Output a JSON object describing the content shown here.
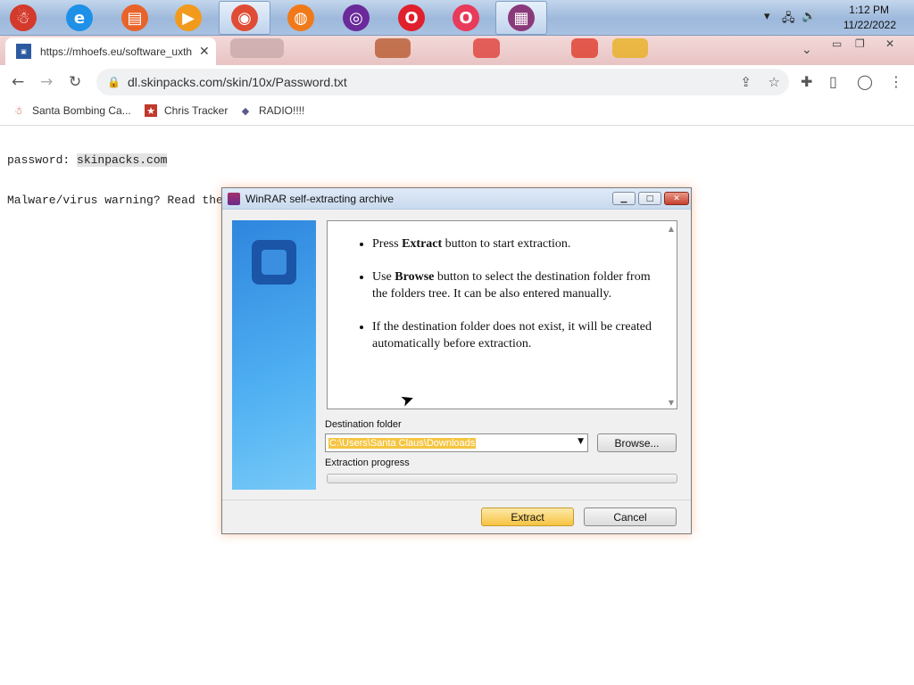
{
  "taskbar": {
    "apps": [
      {
        "name": "santa-icon",
        "color": "#d33a2c",
        "glyph": "☃"
      },
      {
        "name": "internet-explorer-icon",
        "color": "#1e90e8",
        "glyph": "e"
      },
      {
        "name": "file-explorer-icon",
        "color": "#e8632a",
        "glyph": "▤"
      },
      {
        "name": "media-player-icon",
        "color": "#f29a1d",
        "glyph": "▶"
      },
      {
        "name": "chrome-icon",
        "color": "#e04b35",
        "glyph": "◉"
      },
      {
        "name": "firefox-icon",
        "color": "#f07a1a",
        "glyph": "◍"
      },
      {
        "name": "tor-browser-icon",
        "color": "#6a2a9a",
        "glyph": "◎"
      },
      {
        "name": "opera-icon",
        "color": "#e0202c",
        "glyph": "O"
      },
      {
        "name": "opera-gx-icon",
        "color": "#e83a5a",
        "glyph": "O"
      },
      {
        "name": "winrar-icon",
        "color": "#8a3a7a",
        "glyph": "▦"
      }
    ],
    "time": "1:12 PM",
    "date": "11/22/2022"
  },
  "browser": {
    "tab_title": "https://mhoefs.eu/software_uxth",
    "url": "dl.skinpacks.com/skin/10x/Password.txt",
    "bookmarks": [
      "Santa Bombing Ca...",
      "Chris Tracker",
      "RADIO!!!!"
    ]
  },
  "page": {
    "password_label": "password:",
    "password_value": "skinpacks.com",
    "warning_text": "Malware/virus warning? Read the FA"
  },
  "dialog": {
    "title": "WinRAR self-extracting archive",
    "bullets": [
      {
        "pre": "Press ",
        "bold": "Extract",
        "post": " button to start extraction."
      },
      {
        "pre": "Use ",
        "bold": "Browse",
        "post": " button to select the destination folder from the folders tree. It can be also entered manually."
      },
      {
        "pre": "",
        "bold": "",
        "post": "If the destination folder does not exist, it will be created automatically before extraction."
      }
    ],
    "destination_label": "Destination folder",
    "destination_value": "C:\\Users\\Santa Claus\\Downloads",
    "browse_label": "Browse...",
    "progress_label": "Extraction progress",
    "progress_fraction": 0,
    "extract_label": "Extract",
    "cancel_label": "Cancel"
  }
}
